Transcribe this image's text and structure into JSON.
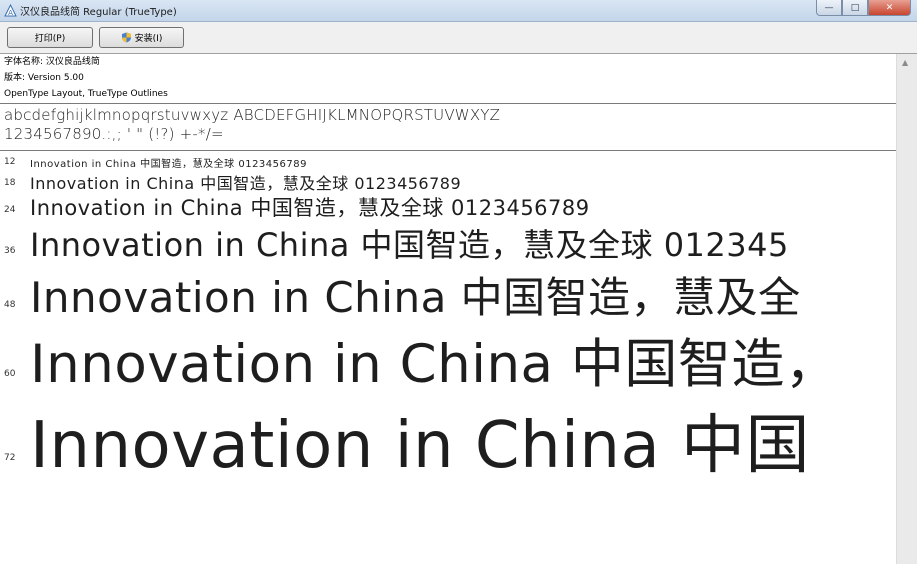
{
  "window": {
    "title": "汉仪良品线简 Regular (TrueType)"
  },
  "toolbar": {
    "print_label": "打印(P)",
    "install_label": "安装(I)"
  },
  "info": {
    "font_name_line": "字体名称: 汉仪良品线简",
    "version_line": "版本: Version 5.00",
    "type_line": "OpenType Layout, TrueType Outlines"
  },
  "charset": {
    "line1": "abcdefghijklmnopqrstuvwxyz ABCDEFGHIJKLMNOPQRSTUVWXYZ",
    "line2": "1234567890.:,; ' \" (!?) +-*/="
  },
  "samples": {
    "s12": {
      "size": "12",
      "text": "Innovation in China 中国智造，慧及全球 0123456789"
    },
    "s18": {
      "size": "18",
      "text": "Innovation in China 中国智造，慧及全球 0123456789"
    },
    "s24": {
      "size": "24",
      "text": "Innovation in China 中国智造，慧及全球 0123456789"
    },
    "s36": {
      "size": "36",
      "text": "Innovation in China 中国智造，慧及全球 012345"
    },
    "s48": {
      "size": "48",
      "text": "Innovation in China 中国智造，慧及全"
    },
    "s60": {
      "size": "60",
      "text": "Innovation in China 中国智造，"
    },
    "s72": {
      "size": "72",
      "text": "Innovation in China 中国"
    }
  },
  "colors": {
    "titlebar": "#c4d5ea",
    "toolbar": "#f0f0f0",
    "close_button": "#c8452f"
  }
}
